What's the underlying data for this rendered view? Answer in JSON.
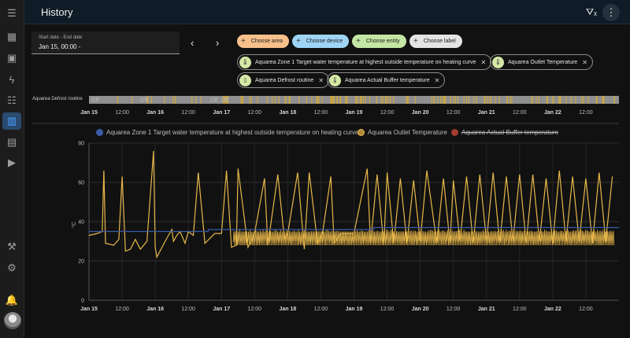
{
  "header": {
    "title": "History"
  },
  "sidebar": {
    "items": [
      {
        "name": "menu-icon",
        "glyph": "☰"
      },
      {
        "name": "overview-icon",
        "glyph": "▦"
      },
      {
        "name": "map-icon",
        "glyph": "▣"
      },
      {
        "name": "energy-icon",
        "glyph": "ϟ"
      },
      {
        "name": "logbook-icon",
        "glyph": "☷"
      },
      {
        "name": "history-icon",
        "glyph": "▥"
      },
      {
        "name": "media-icon",
        "glyph": "▤"
      },
      {
        "name": "media-player-icon",
        "glyph": "▶"
      },
      {
        "name": "developer-tools-icon",
        "glyph": "⚒"
      },
      {
        "name": "settings-icon",
        "glyph": "⚙"
      },
      {
        "name": "notifications-icon",
        "glyph": "🔔"
      }
    ]
  },
  "date": {
    "label": "Start date - End date",
    "value": "Jan 15, 00:00 -"
  },
  "chips": {
    "area": "Choose area",
    "device": "Choose device",
    "entity": "Choose entity",
    "label": "Choose label"
  },
  "selected": {
    "t1": "Aquarea Zone 1 Target water temperature at highest outside temperature on heating curve",
    "t2": "Aquarea Outlet Temperature",
    "t3": "Aquarea Defrost routine",
    "t4": "Aquarea Actual Buffer temperature"
  },
  "timeline": {
    "label": "Aquarea Defrost routine",
    "state_labels": [
      "Off",
      "Off",
      "Off",
      "Off"
    ],
    "x_labels": [
      "Jan 15",
      "12:00",
      "Jan 16",
      "12:00",
      "Jan 17",
      "12:00",
      "Jan 18",
      "12:00",
      "Jan 19",
      "12:00",
      "Jan 20",
      "12:00",
      "Jan 21",
      "12:00",
      "Jan 22",
      "12:00"
    ]
  },
  "chart_data": {
    "type": "line",
    "ylabel": "°C",
    "ylim": [
      0,
      80
    ],
    "yticks": [
      0,
      20,
      40,
      60,
      80
    ],
    "grid": true,
    "legend_placement": "top",
    "x_labels": [
      "Jan 15",
      "12:00",
      "Jan 16",
      "12:00",
      "Jan 17",
      "12:00",
      "Jan 18",
      "12:00",
      "Jan 19",
      "12:00",
      "Jan 20",
      "12:00",
      "Jan 21",
      "12:00",
      "Jan 22",
      "12:00"
    ],
    "series": [
      {
        "name": "Aquarea Zone 1 Target water temperature at highest outside temperature on heating curve",
        "color": "#3a5ba8",
        "hidden": false,
        "x": [
          0,
          3.1,
          3.6,
          8.1,
          8.6
        ],
        "values": [
          35,
          35,
          36,
          36,
          37
        ]
      },
      {
        "name": "Aquarea Outlet Temperature",
        "color": "#e8b84a",
        "hidden": false,
        "x": [
          0,
          0.25,
          0.4,
          0.45,
          0.5,
          0.75,
          0.9,
          1.0,
          1.1,
          1.25,
          1.4,
          1.55,
          1.75,
          1.95,
          2.0,
          2.05,
          2.3,
          2.5,
          2.55,
          2.65,
          2.75,
          2.9,
          3.0,
          3.15,
          3.3,
          3.5,
          3.8,
          4.0,
          4.15,
          4.3,
          4.45,
          4.5,
          4.8,
          5.0,
          5.3,
          5.4,
          5.7,
          5.9,
          6.0,
          6.3,
          6.5,
          6.65,
          6.9,
          7.05,
          7.3,
          7.4,
          7.6,
          7.8,
          8.0,
          8.4,
          8.5,
          8.7,
          8.9,
          9.0,
          9.2,
          9.4,
          9.6,
          9.8,
          10.0,
          10.2,
          10.5,
          10.7,
          10.9,
          11.0,
          11.2,
          11.4,
          11.6,
          11.8,
          12.0,
          12.2,
          12.4,
          12.6,
          12.8,
          13.0,
          13.2,
          13.4,
          13.6,
          13.8,
          14.0,
          14.2,
          14.4,
          14.6,
          14.8,
          15.0,
          15.2,
          15.4,
          15.6,
          15.8
        ],
        "values": [
          33,
          34,
          35,
          66,
          29,
          28,
          31,
          63,
          25,
          26,
          31,
          26,
          30,
          76,
          27,
          22,
          30,
          36,
          30,
          33,
          35,
          29,
          35,
          33,
          65,
          29,
          34,
          34,
          66,
          27,
          28,
          67,
          27,
          34,
          62,
          28,
          64,
          31,
          34,
          65,
          26,
          65,
          29,
          34,
          63,
          29,
          34,
          34,
          34,
          67,
          29,
          64,
          28,
          65,
          29,
          62,
          29,
          61,
          30,
          66,
          29,
          62,
          29,
          61,
          30,
          63,
          29,
          64,
          30,
          65,
          29,
          63,
          30,
          64,
          29,
          64,
          30,
          62,
          29,
          66,
          30,
          63,
          30,
          62,
          29,
          65,
          30,
          63
        ]
      },
      {
        "name": "Aquarea Actual Buffer temperature",
        "color": "#c0392b",
        "hidden": true,
        "x": [],
        "values": []
      }
    ]
  }
}
